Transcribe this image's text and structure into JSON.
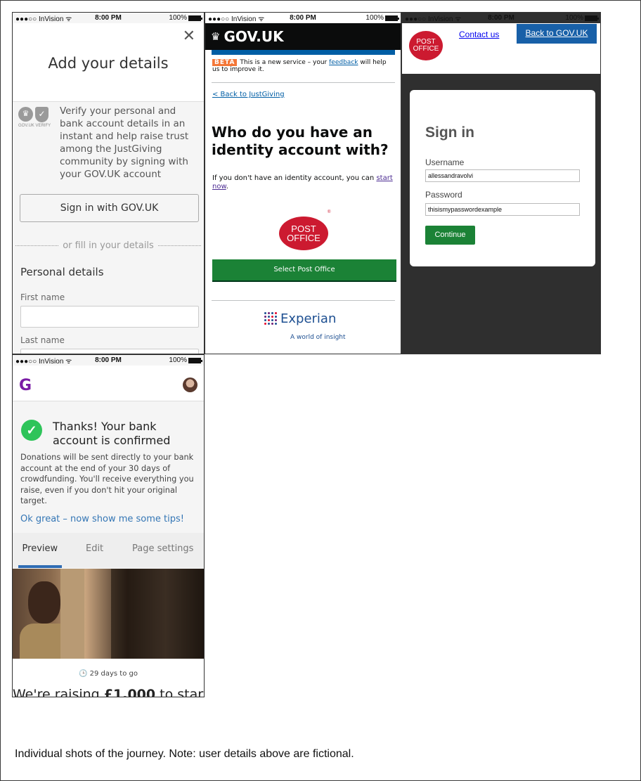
{
  "status_bar": {
    "carrier": "●●●○○ InVision ᯤ",
    "time": "8:00 PM",
    "battery": "100%"
  },
  "screen_add_details": {
    "close_icon": "✕",
    "title": "Add your details",
    "verify_logo_label": "GOV.UK VERIFY",
    "verify_text": "Verify your personal and bank account details in an instant and help raise trust among the JustGiving community by signing with your GOV.UK account",
    "sign_in_button": "Sign in with GOV.UK",
    "divider_text": "or fill in your details",
    "section_title": "Personal details",
    "first_name_label": "First name",
    "first_name_value": "",
    "last_name_label": "Last name",
    "last_name_value": ""
  },
  "screen_govuk": {
    "brand": "GOV.UK",
    "beta_tag": "BETA",
    "beta_text_before": "This is a new service – your",
    "beta_link": "feedback",
    "beta_text_after": "will help us to improve it.",
    "back_link": "< Back to JustGiving",
    "heading": "Who do you have an identity account with?",
    "para_before": "If you don't have an identity account, you can",
    "para_link": "start now",
    "para_after": ".",
    "post_office_logo_line1": "POST",
    "post_office_logo_line2": "OFFICE",
    "registered_mark": "®",
    "select_button": "Select Post Office",
    "experian_name": "Experian",
    "experian_tagline": "A world of insight"
  },
  "screen_post_office": {
    "logo_line1": "POST",
    "logo_line2": "OFFICE",
    "contact_link": "Contact us",
    "back_button": "Back to GOV.UK",
    "sign_in_title": "Sign in",
    "username_label": "Username",
    "username_value": "allessandravolvi",
    "password_label": "Password",
    "password_value": "thisismypasswordexample",
    "continue_button": "Continue"
  },
  "screen_confirmed": {
    "logo_letter": "G",
    "check_icon": "✓",
    "title": "Thanks! Your bank account is confirmed",
    "body": "Donations will be sent directly to your bank account at the end of your 30 days of crowdfunding. You'll receive everything you raise, even if you don't hit your original target.",
    "tips_link": "Ok great – now show me some tips!",
    "tabs": [
      {
        "label": "Preview"
      },
      {
        "label": "Edit"
      },
      {
        "label": "Page settings"
      }
    ],
    "clock_icon": "🕒",
    "days_to_go": "29 days to go",
    "raise_text_before": "We're raising",
    "raise_amount": "£1,000",
    "raise_text_after": "to start"
  },
  "caption": "Individual shots of the journey.  Note:  user details above are fictional."
}
